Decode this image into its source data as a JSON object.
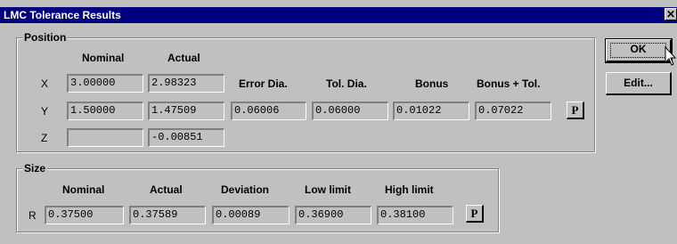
{
  "window": {
    "title": "LMC Tolerance Results",
    "close_glyph": "✕"
  },
  "position": {
    "label": "Position",
    "headers": {
      "nominal": "Nominal",
      "actual": "Actual",
      "error_dia": "Error Dia.",
      "tol_dia": "Tol. Dia.",
      "bonus": "Bonus",
      "bonus_tol": "Bonus + Tol."
    },
    "x": {
      "label": "X",
      "nominal": "3.00000",
      "actual": "2.98323"
    },
    "y": {
      "label": "Y",
      "nominal": "1.50000",
      "actual": "1.47509",
      "error_dia": "0.06006",
      "tol_dia": "0.06000",
      "bonus": "0.01022",
      "bonus_tol": "0.07022",
      "p_label": "P"
    },
    "z": {
      "label": "Z",
      "nominal": "",
      "actual": "-0.00851"
    }
  },
  "size": {
    "label": "Size",
    "headers": {
      "nominal": "Nominal",
      "actual": "Actual",
      "deviation": "Deviation",
      "low": "Low limit",
      "high": "High limit"
    },
    "r": {
      "label": "R",
      "nominal": "0.37500",
      "actual": "0.37589",
      "deviation": "0.00089",
      "low": "0.36900",
      "high": "0.38100",
      "p_label": "P"
    }
  },
  "buttons": {
    "ok": "OK",
    "edit": "Edit..."
  },
  "icons": {
    "cursor": "arrow-cursor-icon"
  }
}
